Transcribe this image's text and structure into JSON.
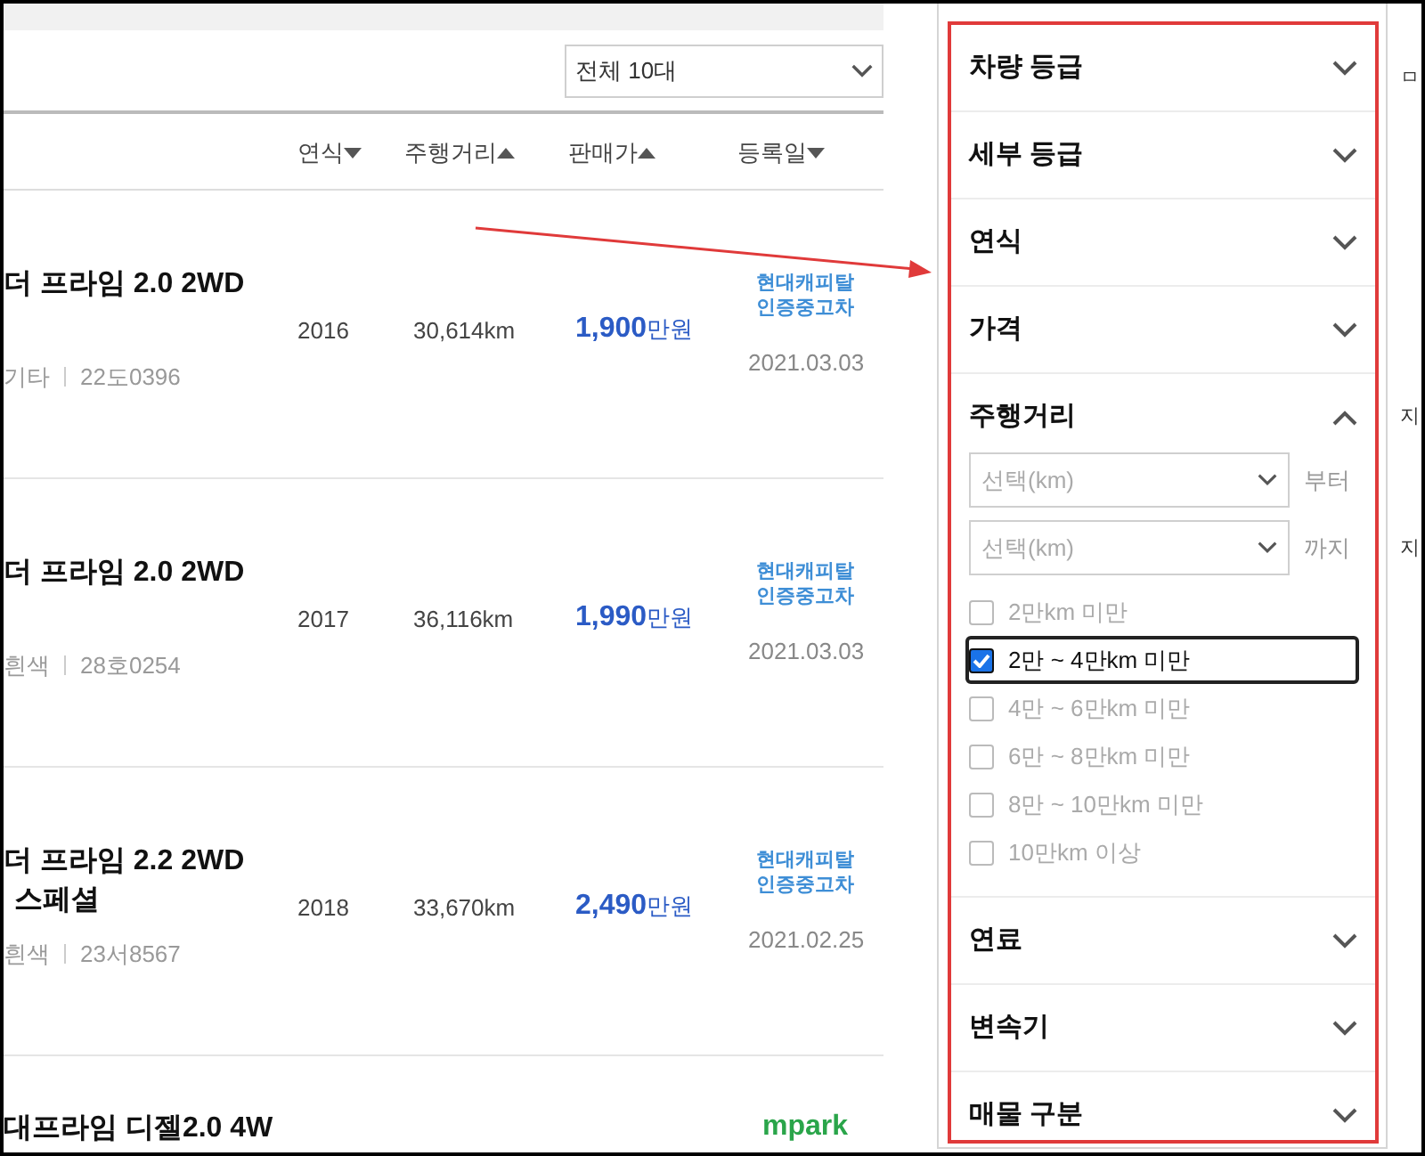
{
  "list_toolbar": {
    "count_select": "전체 10대"
  },
  "sort_headers": [
    {
      "label": "연식",
      "ascending": false
    },
    {
      "label": "주행거리",
      "ascending": true
    },
    {
      "label": "판매가",
      "ascending": true
    },
    {
      "label": "등록일",
      "ascending": false
    }
  ],
  "listings": [
    {
      "title_lines": [
        "더 프라임 2.0 2WD"
      ],
      "details": [
        "기타",
        "22도0396"
      ],
      "year": "2016",
      "mileage": "30,614km",
      "price": "1,900",
      "price_unit": "만원",
      "dealer": {
        "kind": "capital",
        "lines": [
          "현대캐피탈",
          "인증중고차"
        ]
      },
      "date": "2021.03.03"
    },
    {
      "title_lines": [
        "더 프라임 2.0 2WD"
      ],
      "details": [
        "흰색",
        "28호0254"
      ],
      "year": "2017",
      "mileage": "36,116km",
      "price": "1,990",
      "price_unit": "만원",
      "dealer": {
        "kind": "capital",
        "lines": [
          "현대캐피탈",
          "인증중고차"
        ]
      },
      "date": "2021.03.03"
    },
    {
      "title_lines": [
        "더 프라임 2.2 2WD",
        "스페셜"
      ],
      "details": [
        "흰색",
        "23서8567"
      ],
      "year": "2018",
      "mileage": "33,670km",
      "price": "2,490",
      "price_unit": "만원",
      "dealer": {
        "kind": "capital",
        "lines": [
          "현대캐피탈",
          "인증중고차"
        ]
      },
      "date": "2021.02.25"
    },
    {
      "title_lines": [
        "대프라임 디젤2.0 4W"
      ],
      "dealer": {
        "kind": "mpark",
        "lines": [
          "mpark"
        ]
      }
    }
  ],
  "filters": [
    {
      "label": "차량 등급",
      "expanded": false
    },
    {
      "label": "세부 등급",
      "expanded": false
    },
    {
      "label": "연식",
      "expanded": false
    },
    {
      "label": "가격",
      "expanded": false
    },
    {
      "label": "주행거리",
      "expanded": true,
      "ranges": [
        {
          "placeholder": "선택(km)",
          "suffix": "부터"
        },
        {
          "placeholder": "선택(km)",
          "suffix": "까지"
        }
      ],
      "options": [
        {
          "label": "2만km 미만",
          "checked": false,
          "focused": false
        },
        {
          "label": "2만 ~ 4만km 미만",
          "checked": true,
          "focused": true
        },
        {
          "label": "4만 ~ 6만km 미만",
          "checked": false,
          "focused": false
        },
        {
          "label": "6만 ~ 8만km 미만",
          "checked": false,
          "focused": false
        },
        {
          "label": "8만 ~ 10만km 미만",
          "checked": false,
          "focused": false
        },
        {
          "label": "10만km 이상",
          "checked": false,
          "focused": false
        }
      ]
    },
    {
      "label": "연료",
      "expanded": false
    },
    {
      "label": "변속기",
      "expanded": false
    },
    {
      "label": "매물 구분",
      "expanded": false
    }
  ],
  "right_edge_fragments": [
    "ㅁ",
    "지",
    "지"
  ]
}
